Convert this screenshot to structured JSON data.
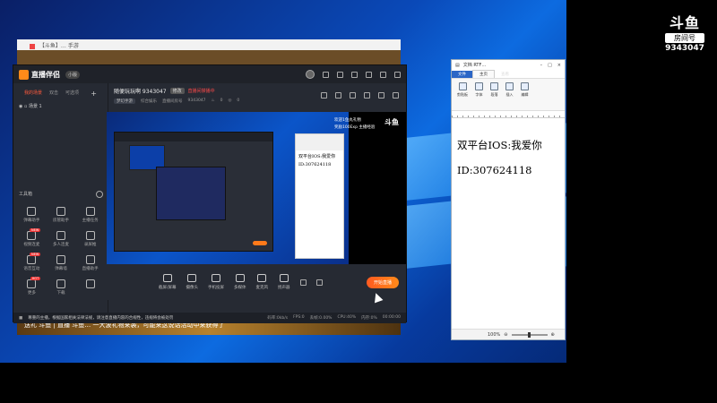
{
  "background_browser": {
    "tab_title": "【斗鱼】… 手游",
    "bottom_text": "送礼  斗鱼  |  直播  斗鱼…  一大波礼物来袭，可能来这说话活动中来获得了"
  },
  "stream_logo": {
    "brand": "斗鱼",
    "room_label": "房间号",
    "room_id": "9343047"
  },
  "app": {
    "name": "直播伴侣",
    "version": "小版",
    "sidebar": {
      "tabs": [
        "我的场景",
        "双击",
        "可选项"
      ],
      "scene_item": "场景 1",
      "tools_title": "工具箱",
      "tools": [
        {
          "label": "弹幕助手",
          "badge": ""
        },
        {
          "label": "房管助手",
          "badge": ""
        },
        {
          "label": "主播任务",
          "badge": ""
        },
        {
          "label": "视频连麦",
          "badge": "NEW"
        },
        {
          "label": "多人连麦",
          "badge": ""
        },
        {
          "label": "录屏推",
          "badge": ""
        },
        {
          "label": "语音互动",
          "badge": "NEW"
        },
        {
          "label": "弹幕墙",
          "badge": ""
        },
        {
          "label": "直播助手",
          "badge": ""
        },
        {
          "label": "更多",
          "badge": "HOT"
        },
        {
          "label": "下载",
          "badge": ""
        },
        {
          "label": "",
          "badge": ""
        }
      ]
    },
    "info": {
      "room_title": "随便玩玩啊 9343047",
      "edit_tag": "修改",
      "live_tag": "直播间禁播中",
      "category_label": "梦幻手游",
      "category_value": "综合娱乐",
      "room_no_label": "直播间房号",
      "room_no_value": "9343047",
      "heat": "0",
      "viewers": "0"
    },
    "preview": {
      "overlay_line1": "欢迎1鱼丸礼物",
      "overlay_line2": "奖励100Exp 主播经验",
      "logo": "斗鱼",
      "doc_line1": "双平台IOS:我爱你",
      "doc_line2": "ID:307624118"
    },
    "toolbar": {
      "buttons": [
        "截屏/屏幕",
        "摄像头",
        "手机投屏",
        "多媒体",
        "麦克风",
        "扬声器"
      ],
      "go_live": "开始直播"
    },
    "status": {
      "notice": "尊重的主播，根据国家相关法律法规，请注意直播内容的合规性，违规将会被处罚",
      "stats": [
        "码率:0kb/s",
        "FPS:0",
        "丢帧:0.00%",
        "CPU:40%",
        "内存:0%"
      ],
      "time": "00:00:00"
    }
  },
  "doc": {
    "title": "文档 RTF…",
    "tabs": [
      "文件",
      "主页",
      "查看"
    ],
    "ribbon": [
      "剪贴板",
      "字体",
      "段落",
      "插入",
      "编辑"
    ],
    "line1": "双平台IOS:我爱你",
    "line2": "ID:307624118",
    "zoom": "100%"
  }
}
